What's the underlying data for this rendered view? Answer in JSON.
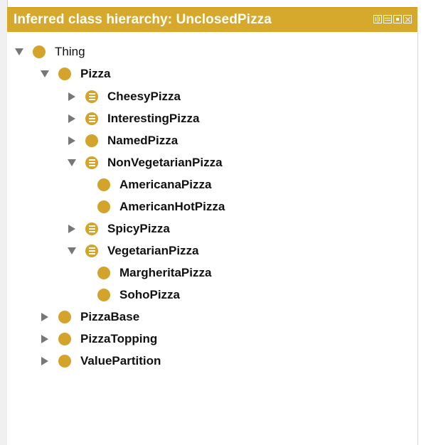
{
  "panel": {
    "title": "Inferred class hierarchy: UnclosedPizza"
  },
  "tree": [
    {
      "label": "Thing",
      "expanded": true
    },
    {
      "label": "Pizza",
      "expanded": true
    },
    {
      "label": "CheesyPizza",
      "expanded": false
    },
    {
      "label": "InterestingPizza",
      "expanded": false
    },
    {
      "label": "NamedPizza",
      "expanded": false
    },
    {
      "label": "NonVegetarianPizza",
      "expanded": true
    },
    {
      "label": "AmericanaPizza"
    },
    {
      "label": "AmericanHotPizza"
    },
    {
      "label": "SpicyPizza",
      "expanded": false
    },
    {
      "label": "VegetarianPizza",
      "expanded": true
    },
    {
      "label": "MargheritaPizza"
    },
    {
      "label": "SohoPizza"
    },
    {
      "label": "PizzaBase",
      "expanded": false
    },
    {
      "label": "PizzaTopping",
      "expanded": false
    },
    {
      "label": "ValuePartition",
      "expanded": false
    }
  ],
  "icons": {
    "class": "class-icon",
    "defined_class": "defined-class-icon",
    "expanded": "triangle-down-icon",
    "collapsed": "triangle-right-icon"
  },
  "colors": {
    "header_background": "#d6a82b",
    "class_icon": "#d4a32c",
    "text": "#111111"
  }
}
